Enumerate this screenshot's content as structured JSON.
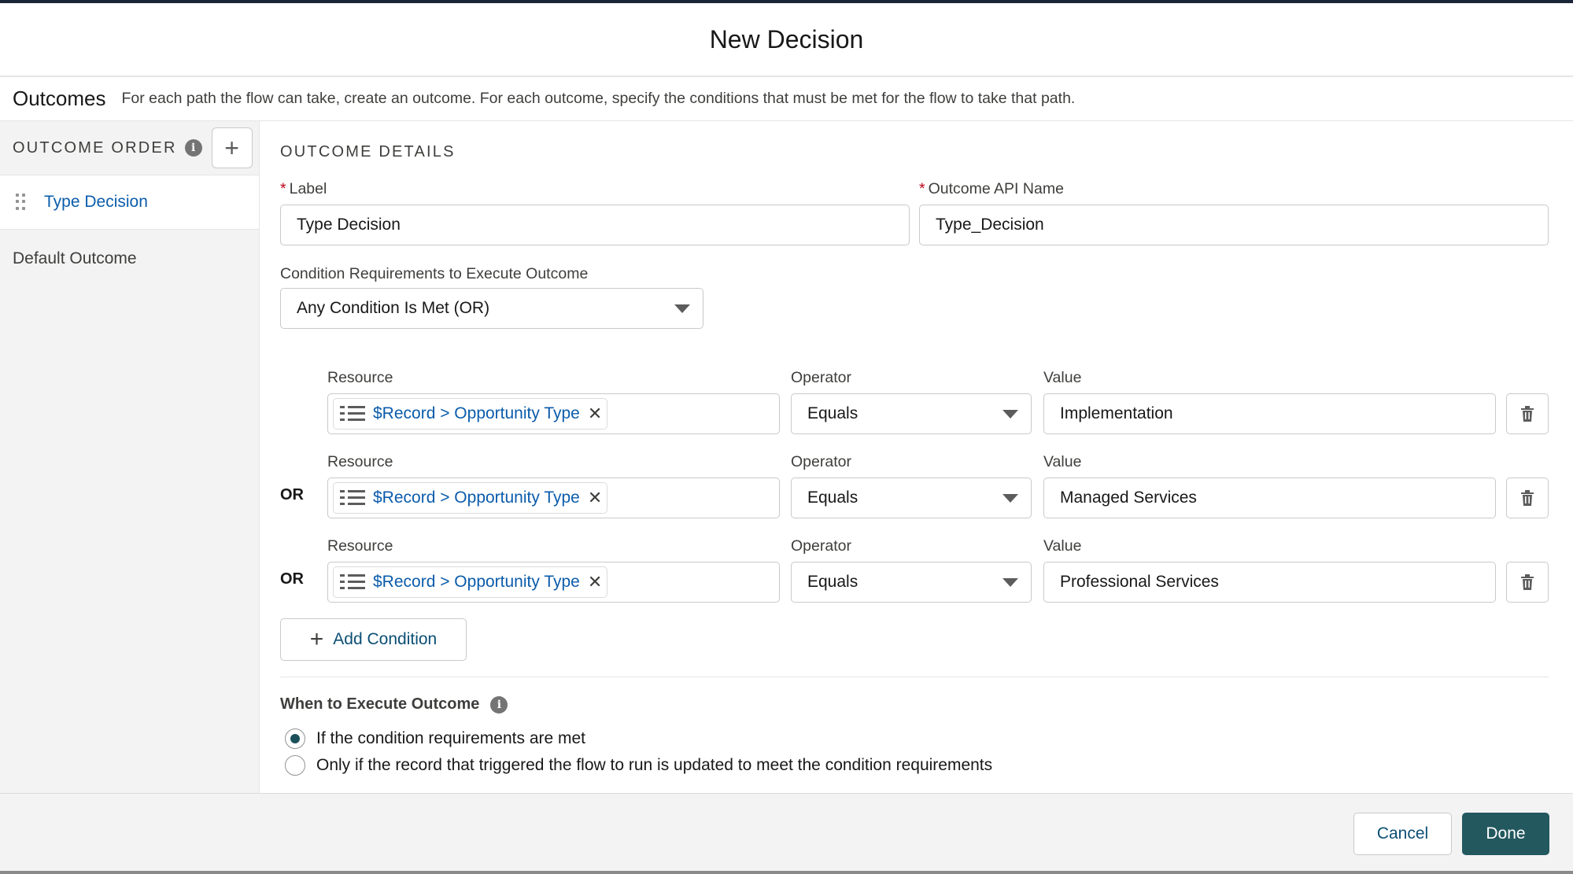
{
  "dialog": {
    "title": "New Decision"
  },
  "outcomes": {
    "title": "Outcomes",
    "description": "For each path the flow can take, create an outcome. For each outcome, specify the conditions that must be met for the flow to take that path."
  },
  "sidebar": {
    "order_label": "OUTCOME ORDER",
    "info_icon": "info-icon",
    "add_icon": "plus-icon",
    "items": [
      {
        "label": "Type Decision",
        "active": true
      },
      {
        "label": "Default Outcome",
        "active": false
      }
    ]
  },
  "details": {
    "section_title": "OUTCOME DETAILS",
    "label_field": {
      "label": "Label",
      "required": "*",
      "value": "Type Decision"
    },
    "api_name_field": {
      "label": "Outcome API Name",
      "required": "*",
      "value": "Type_Decision"
    },
    "condition_requirements": {
      "label": "Condition Requirements to Execute Outcome",
      "value": "Any Condition Is Met (OR)"
    },
    "conditions": [
      {
        "connector": "",
        "resource_label": "Resource",
        "resource": "$Record > Opportunity Type",
        "operator_label": "Operator",
        "operator": "Equals",
        "value_label": "Value",
        "value": "Implementation"
      },
      {
        "connector": "OR",
        "resource_label": "Resource",
        "resource": "$Record > Opportunity Type",
        "operator_label": "Operator",
        "operator": "Equals",
        "value_label": "Value",
        "value": "Managed Services"
      },
      {
        "connector": "OR",
        "resource_label": "Resource",
        "resource": "$Record > Opportunity Type",
        "operator_label": "Operator",
        "operator": "Equals",
        "value_label": "Value",
        "value": "Professional Services"
      }
    ],
    "add_condition_label": "Add Condition",
    "when_to_execute": {
      "title": "When to Execute Outcome",
      "options": [
        {
          "label": "If the condition requirements are met",
          "selected": true
        },
        {
          "label": "Only if the record that triggered the flow to run is updated to meet the condition requirements",
          "selected": false
        }
      ]
    }
  },
  "footer": {
    "cancel_label": "Cancel",
    "done_label": "Done"
  },
  "colors": {
    "link": "#0b5cab",
    "brand_button": "#23585f",
    "required": "#ba0517"
  }
}
